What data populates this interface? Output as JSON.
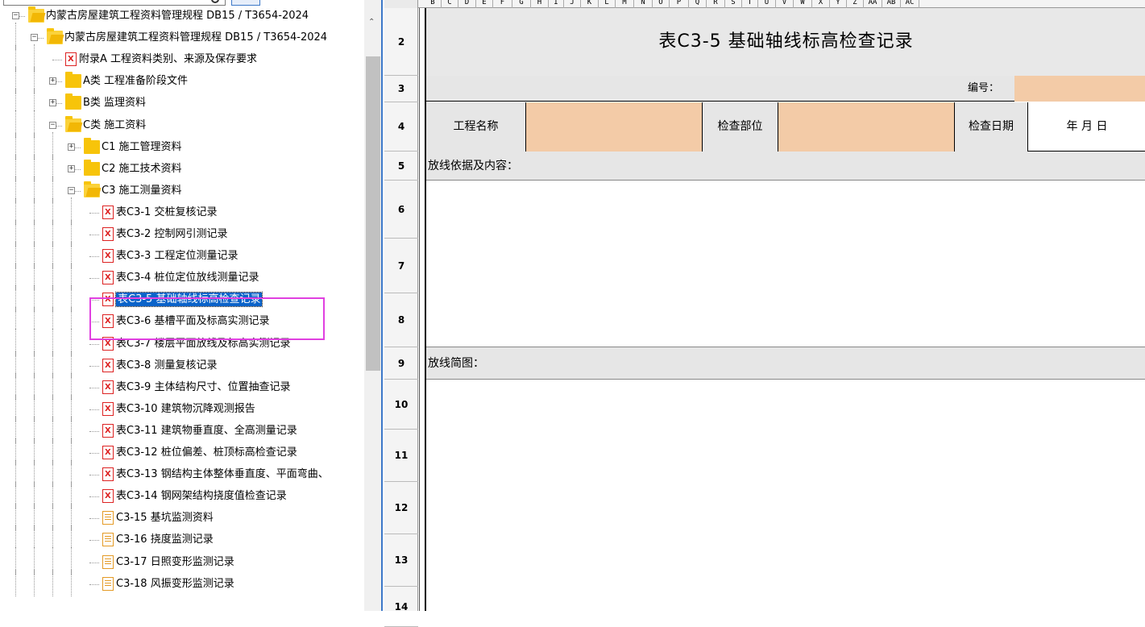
{
  "tree": {
    "items": [
      {
        "label": "内蒙古房屋建筑工程资料管理规程 DB15 / T3654-2024",
        "type": "folder-open",
        "expander": "−"
      },
      {
        "label": "内蒙古房屋建筑工程资料管理规程 DB15 / T3654-2024",
        "type": "folder-open",
        "expander": "−"
      },
      {
        "label": "附录A  工程资料类别、来源及保存要求",
        "type": "xls"
      },
      {
        "label": "A类 工程准备阶段文件",
        "type": "folder",
        "expander": "+"
      },
      {
        "label": "B类 监理资料",
        "type": "folder",
        "expander": "+"
      },
      {
        "label": "C类 施工资料",
        "type": "folder-open",
        "expander": "−"
      },
      {
        "label": "C1 施工管理资料",
        "type": "folder",
        "expander": "+"
      },
      {
        "label": "C2 施工技术资料",
        "type": "folder",
        "expander": "+"
      },
      {
        "label": "C3 施工测量资料",
        "type": "folder-open",
        "expander": "−"
      },
      {
        "label": "表C3-1 交桩复核记录",
        "type": "xls"
      },
      {
        "label": "表C3-2 控制网引测记录",
        "type": "xls"
      },
      {
        "label": "表C3-3 工程定位测量记录",
        "type": "xls"
      },
      {
        "label": "表C3-4 桩位定位放线测量记录",
        "type": "xls"
      },
      {
        "label": "表C3-5 基础轴线标高检查记录",
        "type": "xls",
        "selected": true
      },
      {
        "label": "表C3-6 基槽平面及标高实测记录",
        "type": "xls"
      },
      {
        "label": "表C3-7 楼层平面放线及标高实测记录",
        "type": "xls"
      },
      {
        "label": "表C3-8 测量复核记录",
        "type": "xls"
      },
      {
        "label": "表C3-9 主体结构尺寸、位置抽查记录",
        "type": "xls"
      },
      {
        "label": "表C3-10 建筑物沉降观测报告",
        "type": "xls"
      },
      {
        "label": "表C3-11 建筑物垂直度、全高测量记录",
        "type": "xls"
      },
      {
        "label": "表C3-12 桩位偏差、桩顶标高检查记录",
        "type": "xls"
      },
      {
        "label": "表C3-13 钢结构主体整体垂直度、平面弯曲、",
        "type": "xls"
      },
      {
        "label": "表C3-14 钢网架结构挠度值检查记录",
        "type": "xls"
      },
      {
        "label": "C3-15 基坑监测资料",
        "type": "doc"
      },
      {
        "label": "C3-16 挠度监测记录",
        "type": "doc"
      },
      {
        "label": "C3-17 日照变形监测记录",
        "type": "doc"
      },
      {
        "label": "C3-18 风振变形监测记录",
        "type": "doc"
      }
    ]
  },
  "sheet": {
    "columns": [
      "B",
      "C",
      "D",
      "E",
      "F",
      "G",
      "H",
      "I",
      "J",
      "K",
      "L",
      "M",
      "N",
      "O",
      "P",
      "Q",
      "R",
      "S",
      "T",
      "U",
      "V",
      "W",
      "X",
      "Y",
      "Z",
      "AA",
      "AB",
      "AC"
    ],
    "rows": [
      "2",
      "3",
      "4",
      "5",
      "6",
      "7",
      "8",
      "9",
      "10",
      "11",
      "12",
      "13",
      "14"
    ],
    "title": "表C3-5  基础轴线标高检查记录",
    "code_label": "编号：",
    "project_name_label": "工程名称",
    "check_part_label": "检查部位",
    "check_date_label": "检查日期",
    "date_placeholder": "年   月   日",
    "basis_label": "放线依据及内容：",
    "sketch_label": "放线简图："
  },
  "colors": {
    "accent": "#0a63c9",
    "input_fill": "#f3cba7",
    "highlight": "#e040e0"
  }
}
